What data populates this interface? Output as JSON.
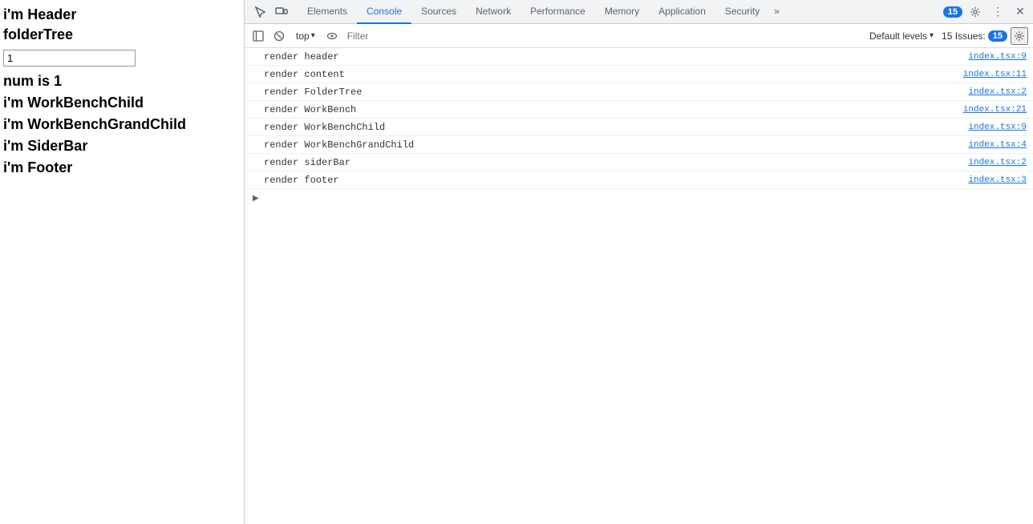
{
  "webpage": {
    "header": "i'm Header",
    "folderTree": "folderTree",
    "inputValue": "1",
    "numLabel": "num is 1",
    "workBenchChild": "i'm WorkBenchChild",
    "workBenchGrandChild": "i'm WorkBenchGrandChild",
    "siderBar": "i'm SiderBar",
    "footer": "i'm Footer"
  },
  "devtools": {
    "tabs": [
      {
        "id": "elements",
        "label": "Elements",
        "active": false
      },
      {
        "id": "console",
        "label": "Console",
        "active": true
      },
      {
        "id": "sources",
        "label": "Sources",
        "active": false
      },
      {
        "id": "network",
        "label": "Network",
        "active": false
      },
      {
        "id": "performance",
        "label": "Performance",
        "active": false
      },
      {
        "id": "memory",
        "label": "Memory",
        "active": false
      },
      {
        "id": "application",
        "label": "Application",
        "active": false
      },
      {
        "id": "security",
        "label": "Security",
        "active": false
      }
    ],
    "moreTabsLabel": "»",
    "issuesCount": "15",
    "toolbar": {
      "contextSelector": "top",
      "filterPlaceholder": "Filter",
      "defaultLevels": "Default levels",
      "issuesLabel": "15 Issues:",
      "issuesNum": "15"
    },
    "consoleMessages": [
      {
        "text": "render header",
        "file": "index.tsx:9"
      },
      {
        "text": "render content",
        "file": "index.tsx:11"
      },
      {
        "text": "render FolderTree",
        "file": "index.tsx:2"
      },
      {
        "text": "render WorkBench",
        "file": "index.tsx:21"
      },
      {
        "text": "render WorkBenchChild",
        "file": "index.tsx:9"
      },
      {
        "text": "render WorkBenchGrandChild",
        "file": "index.tsx:4"
      },
      {
        "text": "render siderBar",
        "file": "index.tsx:2"
      },
      {
        "text": "render footer",
        "file": "index.tsx:3"
      }
    ]
  }
}
